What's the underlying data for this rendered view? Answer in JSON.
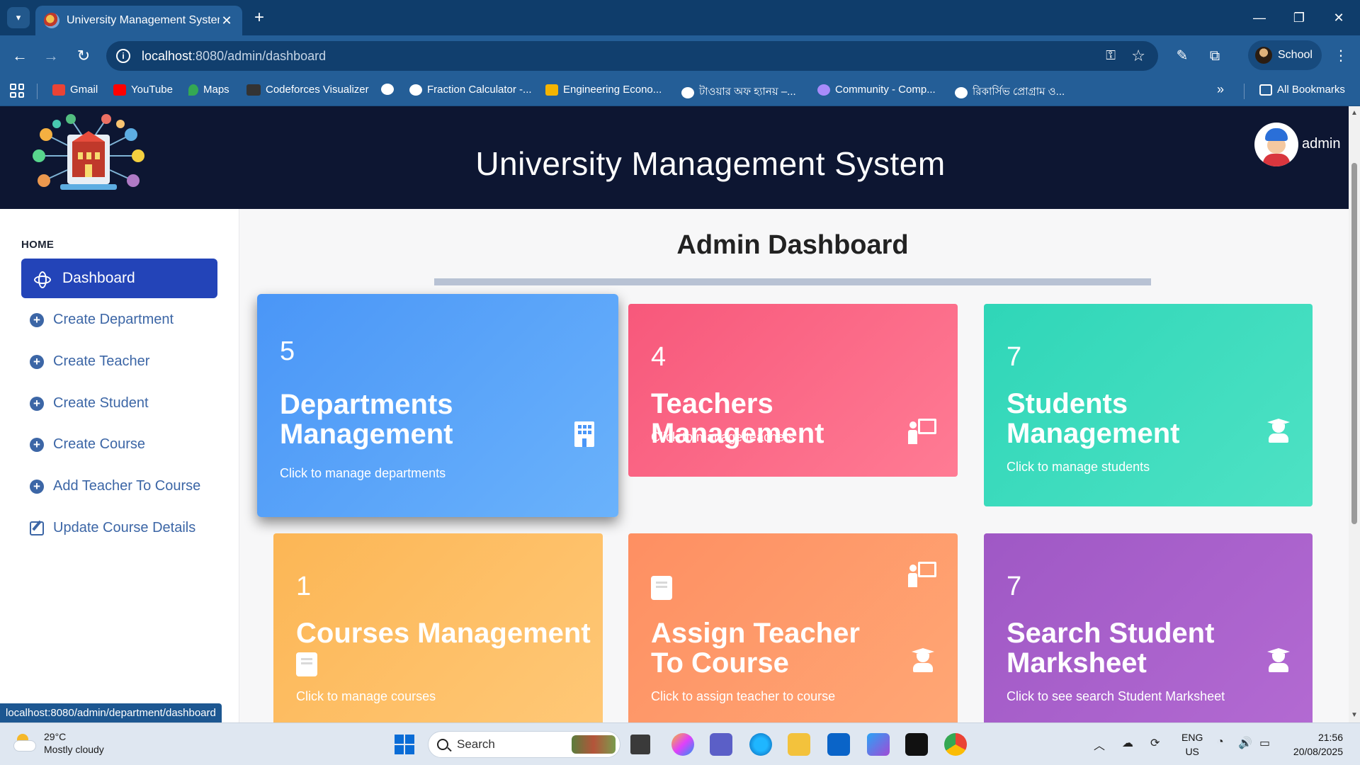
{
  "browser": {
    "tab_title": "University Management System",
    "url_host": "localhost",
    "url_path": ":8080/admin/dashboard",
    "profile_name": "School",
    "bookmarks": [
      {
        "label": "Gmail",
        "color": "#ea4335"
      },
      {
        "label": "YouTube",
        "color": "#ff0000"
      },
      {
        "label": "Maps",
        "color": "#34a853"
      },
      {
        "label": "Codeforces Visualizer",
        "color": "#333333"
      },
      {
        "label": "",
        "color": "#ffffff"
      },
      {
        "label": "Fraction Calculator -...",
        "color": "#ffffff"
      },
      {
        "label": "Engineering Econo...",
        "color": "#f4b400"
      },
      {
        "label": "টাওয়ার অফ হ্যানয় –...",
        "color": "#ffffff"
      },
      {
        "label": "Community - Comp...",
        "color": "#a78bfa"
      },
      {
        "label": "রিকার্সিভ প্রোগ্রাম ও...",
        "color": "#ffffff"
      }
    ],
    "all_bookmarks": "All Bookmarks",
    "status_url": "localhost:8080/admin/department/dashboard"
  },
  "header": {
    "title": "University Management System",
    "user": "admin"
  },
  "sidebar": {
    "section": "HOME",
    "active": "Dashboard",
    "items": [
      {
        "label": "Create Department"
      },
      {
        "label": "Create Teacher"
      },
      {
        "label": "Create Student"
      },
      {
        "label": "Create Course"
      },
      {
        "label": "Add Teacher To Course"
      },
      {
        "label": "Update Course Details"
      }
    ]
  },
  "main": {
    "title": "Admin Dashboard",
    "cards": {
      "departments": {
        "count": "5",
        "title": "Departments Management",
        "subtitle": "Click to manage departments",
        "color": "#4a96f7",
        "icon": "building-icon"
      },
      "teachers": {
        "count": "4",
        "title": "Teachers Management",
        "subtitle": "Click to manage teachers",
        "color": "#f7587b",
        "icon": "teacher-icon"
      },
      "students": {
        "count": "7",
        "title": "Students Management",
        "subtitle": "Click to manage students",
        "color": "#2fd6b8",
        "icon": "graduate-icon"
      },
      "courses": {
        "count": "1",
        "title": "Courses Management",
        "subtitle": "Click to manage courses",
        "color": "#fcb655",
        "icon": "book-icon"
      },
      "assign": {
        "title": "Assign Teacher To Course",
        "subtitle": "Click to assign teacher to course",
        "color": "#fe8f62",
        "icon": "book-icon"
      },
      "search": {
        "count": "7",
        "title": "Search Student Marksheet",
        "subtitle": "Click to see search Student Marksheet",
        "color": "#9f58c5",
        "icon": "graduate-icon"
      }
    }
  },
  "taskbar": {
    "temperature": "29°C",
    "weather": "Mostly cloudy",
    "search_placeholder": "Search",
    "lang_top": "ENG",
    "lang_bottom": "US",
    "time": "21:56",
    "date": "20/08/2025"
  }
}
